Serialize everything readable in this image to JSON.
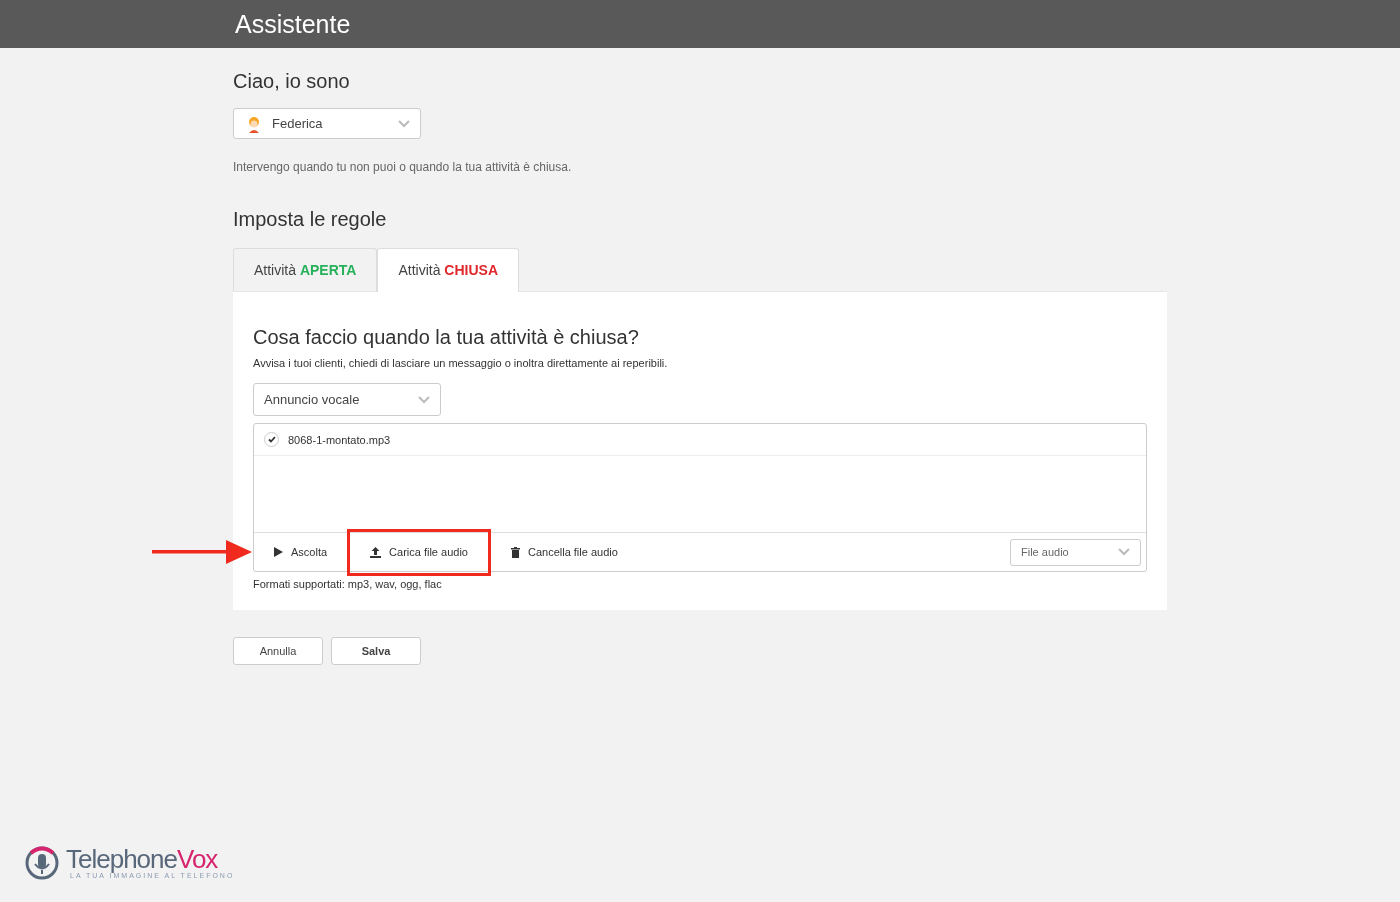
{
  "header": {
    "title": "Assistente"
  },
  "assistant": {
    "heading": "Ciao, io sono",
    "selected_name": "Federica",
    "description": "Intervengo quando tu non puoi o quando la tua attività è chiusa."
  },
  "rules": {
    "heading": "Imposta le regole",
    "tabs": [
      {
        "label": "Attività",
        "status": "APERTA",
        "color": "#27b15b",
        "selected": false
      },
      {
        "label": "Attività",
        "status": "CHIUSA",
        "color": "#e0272b",
        "selected": true
      }
    ]
  },
  "panel": {
    "title": "Cosa faccio quando la tua attività è chiusa?",
    "subtitle": "Avvisa i tuoi clienti, chiedi di lasciare un messaggio o inoltra direttamente ai reperibili.",
    "action_select": "Annuncio vocale",
    "files": [
      {
        "name": "8068-1-montato.mp3",
        "checked": true
      }
    ],
    "toolbar": [
      {
        "kind": "play",
        "label": "Ascolta",
        "highlighted": false
      },
      {
        "kind": "upload",
        "label": "Carica file audio",
        "highlighted": true
      },
      {
        "kind": "delete",
        "label": "Cancella file audio",
        "highlighted": false
      }
    ],
    "source_select": "File audio",
    "formats": "Formati supportati: mp3, wav, ogg, flac"
  },
  "buttons": [
    {
      "label": "Annulla",
      "kind": "secondary"
    },
    {
      "label": "Salva",
      "kind": "primary"
    }
  ],
  "logo": {
    "name_part1": "Telephone",
    "name_part2": "Vox",
    "tagline": "LA TUA IMMAGINE AL TELEFONO"
  }
}
